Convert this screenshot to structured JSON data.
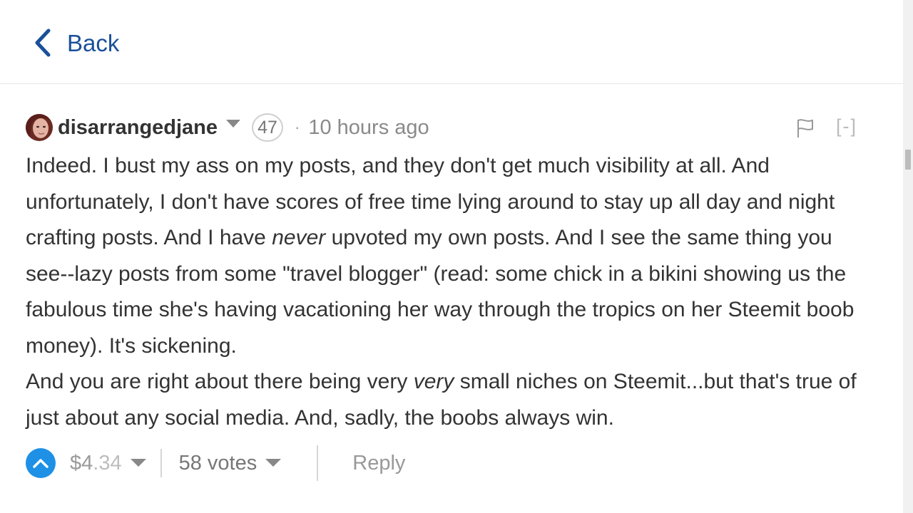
{
  "header": {
    "back_label": "Back"
  },
  "comment": {
    "author": "disarrangedjane",
    "reputation": "47",
    "separator": "·",
    "timestamp": "10 hours ago",
    "collapse_label": "[-]",
    "body": {
      "p1_a": "Indeed. I bust my ass on my posts, and they don't get much visibility at all. And unfortunately, I don't have scores of free time lying around to stay up all day and night crafting posts. And I have ",
      "p1_em": "never",
      "p1_b": " upvoted my own posts. And I see the same thing you see--lazy posts from some \"travel blogger\" (read: some chick in a bikini showing us the fabulous time she's having vacationing her way through the tropics on her Steemit boob money). It's sickening.",
      "p2_a": "And you are right about there being very ",
      "p2_em": "very",
      "p2_b": " small niches on Steemit...but that's true of just about any social media. And, sadly, the boobs always win."
    },
    "footer": {
      "payout_currency": "$",
      "payout_whole": "4",
      "payout_cents": ".34",
      "votes_label": "58 votes",
      "reply_label": "Reply"
    }
  },
  "colors": {
    "link_blue": "#1a5099",
    "upvote_blue": "#1e90e6",
    "text": "#333333",
    "muted": "#8a8a8a"
  },
  "icons": [
    "chevron-left-icon",
    "avatar",
    "chevron-down-icon",
    "flag-icon",
    "upvote-icon"
  ]
}
